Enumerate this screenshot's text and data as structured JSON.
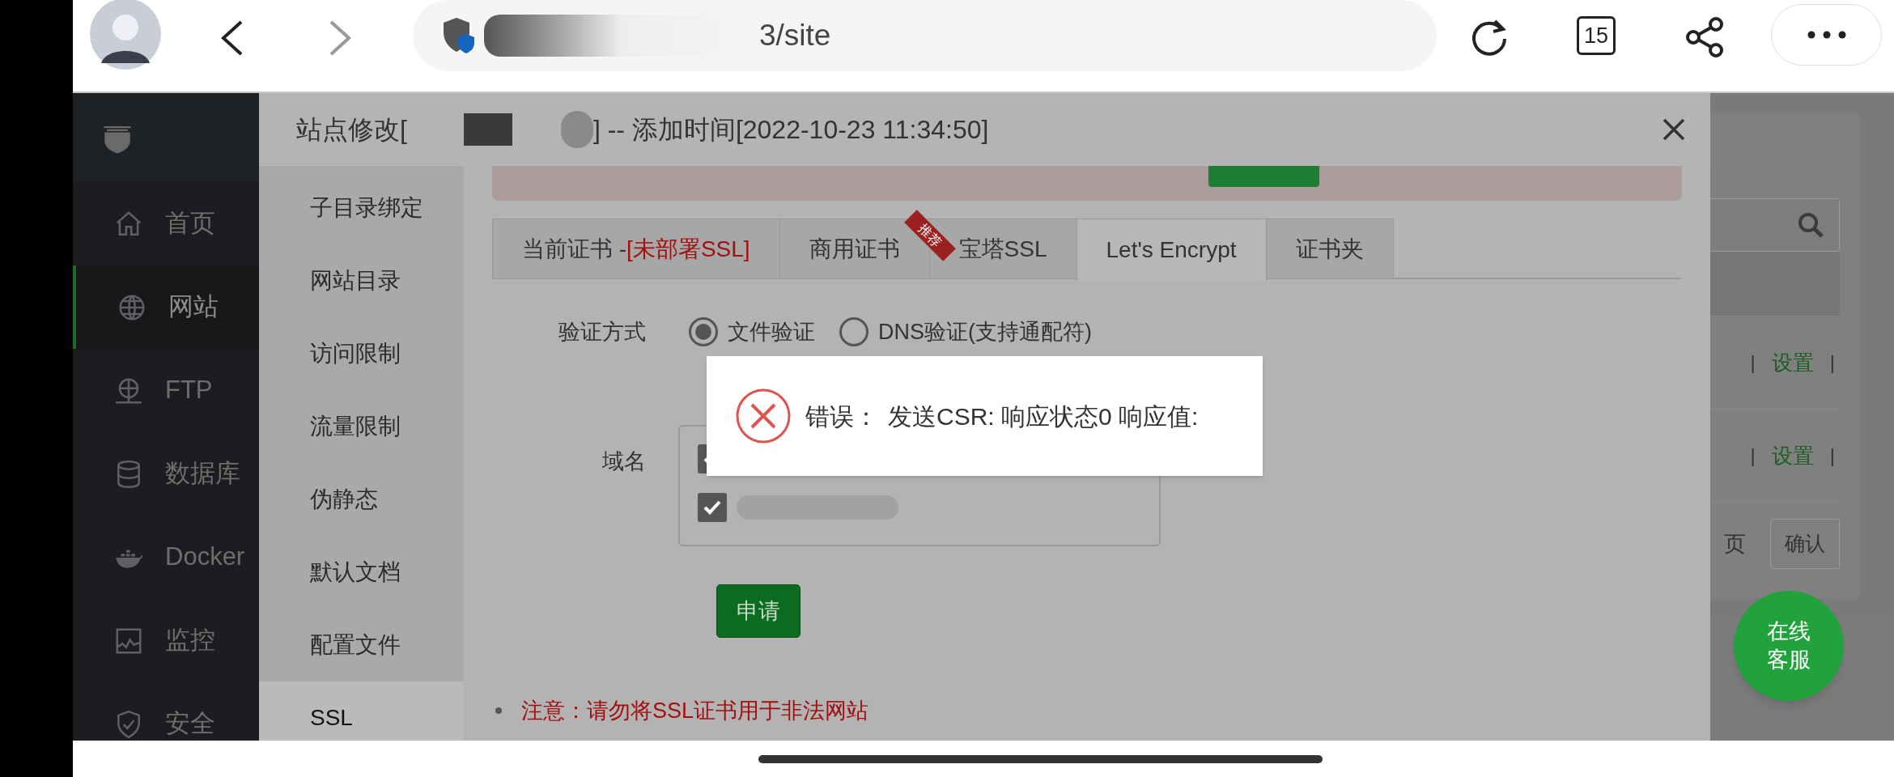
{
  "browser": {
    "url": "3/site",
    "tab_count": "15"
  },
  "sidebar": {
    "items": [
      {
        "label": "首页",
        "kind": "home",
        "selected": false
      },
      {
        "label": "网站",
        "kind": "globe",
        "selected": true
      },
      {
        "label": "FTP",
        "kind": "ftp",
        "selected": false
      },
      {
        "label": "数据库",
        "kind": "database",
        "selected": false
      },
      {
        "label": "Docker",
        "kind": "docker",
        "selected": false
      },
      {
        "label": "监控",
        "kind": "monitor",
        "selected": false
      },
      {
        "label": "安全",
        "kind": "shield",
        "selected": false
      }
    ]
  },
  "dialog": {
    "title_start": "站点修改[",
    "title_end": "] -- 添加时间[2022-10-23 11:34:50]",
    "menu": [
      {
        "label": "子目录绑定",
        "selected": false
      },
      {
        "label": "网站目录",
        "selected": false
      },
      {
        "label": "访问限制",
        "selected": false
      },
      {
        "label": "流量限制",
        "selected": false
      },
      {
        "label": "伪静态",
        "selected": false
      },
      {
        "label": "默认文档",
        "selected": false
      },
      {
        "label": "配置文件",
        "selected": false
      },
      {
        "label": "SSL",
        "selected": true
      }
    ],
    "tabs": [
      {
        "label": "当前证书 - ",
        "note": "[未部署SSL]",
        "selected": false
      },
      {
        "label": "商用证书",
        "ribbon": "推荐",
        "selected": false
      },
      {
        "label": "宝塔SSL",
        "selected": false
      },
      {
        "label": "Let's Encrypt",
        "selected": true
      },
      {
        "label": "证书夹",
        "selected": false
      }
    ],
    "verify": {
      "label": "验证方式",
      "options": [
        {
          "label": "文件验证",
          "selected": true
        },
        {
          "label": "DNS验证(支持通配符)",
          "selected": false
        }
      ]
    },
    "domain": {
      "label": "域名",
      "entries": [
        {
          "checked": true
        },
        {
          "checked": true
        }
      ]
    },
    "apply_button": "申请",
    "notice": "注意：请勿将SSL证书用于非法网站",
    "toast": {
      "label": "错误：",
      "message": "发送CSR: 响应状态0 响应值:"
    }
  },
  "background": {
    "rows": [
      {
        "cells": [
          {
            "kind": "separator",
            "text": "|"
          },
          {
            "kind": "link",
            "text": "设置"
          },
          {
            "kind": "separator",
            "text": "|"
          }
        ]
      },
      {
        "cells": [
          {
            "kind": "separator",
            "text": "|"
          },
          {
            "kind": "link",
            "text": "设置"
          },
          {
            "kind": "separator",
            "text": "|"
          }
        ]
      }
    ],
    "page_label": "页",
    "confirm_button": "确认"
  },
  "chat_button": {
    "lines": [
      "在线",
      "客服"
    ]
  }
}
